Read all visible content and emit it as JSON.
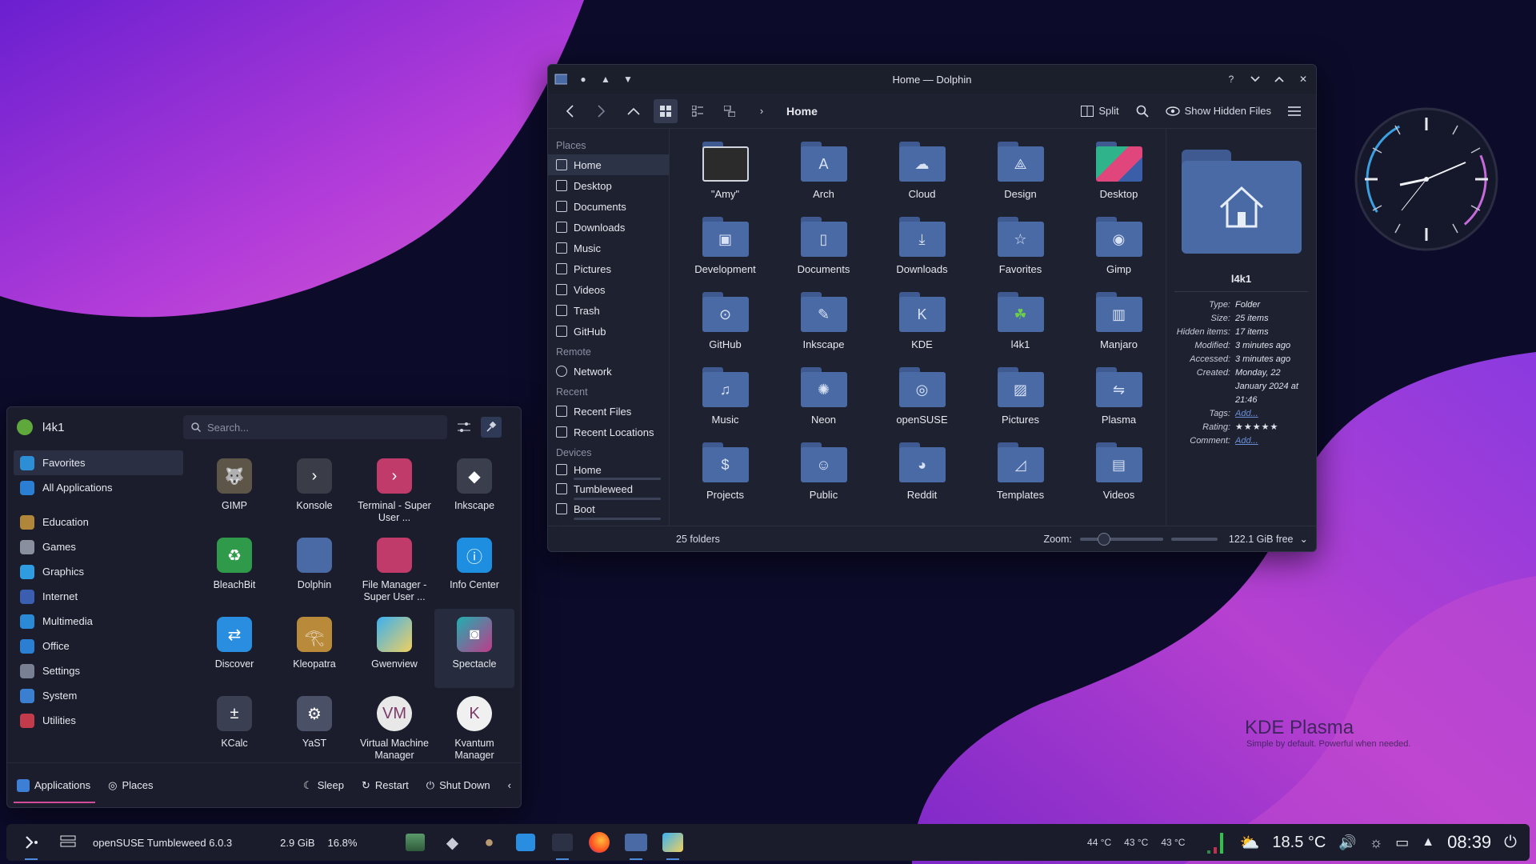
{
  "desktop": {
    "brand_name": "KDE Plasma",
    "brand_tagline": "Simple by default. Powerful when  needed."
  },
  "dolphin": {
    "title": "Home — Dolphin",
    "breadcrumb": "Home",
    "split_label": "Split",
    "show_hidden_label": "Show Hidden Files",
    "places": {
      "places_heading": "Places",
      "places_items": [
        "Home",
        "Desktop",
        "Documents",
        "Downloads",
        "Music",
        "Pictures",
        "Videos",
        "Trash",
        "GitHub"
      ],
      "remote_heading": "Remote",
      "remote_items": [
        "Network"
      ],
      "recent_heading": "Recent",
      "recent_items": [
        "Recent Files",
        "Recent Locations"
      ],
      "devices_heading": "Devices",
      "devices_items": [
        "Home",
        "Tumbleweed",
        "Boot"
      ]
    },
    "folders": [
      "\"Amy\"",
      "Arch",
      "Cloud",
      "Design",
      "Desktop",
      "Development",
      "Documents",
      "Downloads",
      "Favorites",
      "Gimp",
      "GitHub",
      "Inkscape",
      "KDE",
      "l4k1",
      "Manjaro",
      "Music",
      "Neon",
      "openSUSE",
      "Pictures",
      "Plasma",
      "Projects",
      "Public",
      "Reddit",
      "Templates",
      "Videos"
    ],
    "info": {
      "name": "l4k1",
      "type_k": "Type:",
      "type_v": "Folder",
      "size_k": "Size:",
      "size_v": "25 items",
      "hidden_k": "Hidden items:",
      "hidden_v": "17 items",
      "modified_k": "Modified:",
      "modified_v": "3 minutes ago",
      "accessed_k": "Accessed:",
      "accessed_v": "3 minutes ago",
      "created_k": "Created:",
      "created_v": "Monday, 22 January 2024 at 21:46",
      "tags_k": "Tags:",
      "tags_v": "Add...",
      "rating_k": "Rating:",
      "rating_v": "★★★★★",
      "comment_k": "Comment:",
      "comment_v": "Add..."
    },
    "status": {
      "count": "25 folders",
      "zoom_label": "Zoom:",
      "free": "122.1 GiB free"
    }
  },
  "launcher": {
    "username": "l4k1",
    "search_placeholder": "Search...",
    "categories": [
      "Favorites",
      "All Applications",
      "Education",
      "Games",
      "Graphics",
      "Internet",
      "Multimedia",
      "Office",
      "Settings",
      "System",
      "Utilities"
    ],
    "apps": [
      "GIMP",
      "Konsole",
      "Terminal - Super User ...",
      "Inkscape",
      "BleachBit",
      "Dolphin",
      "File Manager - Super User ...",
      "Info Center",
      "Discover",
      "Kleopatra",
      "Gwenview",
      "Spectacle",
      "KCalc",
      "YaST",
      "Virtual Machine Manager",
      "Kvantum Manager"
    ],
    "footer": {
      "applications": "Applications",
      "places": "Places",
      "sleep": "Sleep",
      "restart": "Restart",
      "shutdown": "Shut Down"
    }
  },
  "taskbar": {
    "distro": "openSUSE Tumbleweed 6.0.3",
    "memory": "2.9 GiB",
    "cpu": "16.8%",
    "temps": [
      "44 °C",
      "43 °C",
      "43 °C"
    ],
    "weather": "18.5 °C",
    "time": "08:39"
  },
  "colors": {
    "accent": "#4a6aa6",
    "highlight": "#d24b9a"
  }
}
